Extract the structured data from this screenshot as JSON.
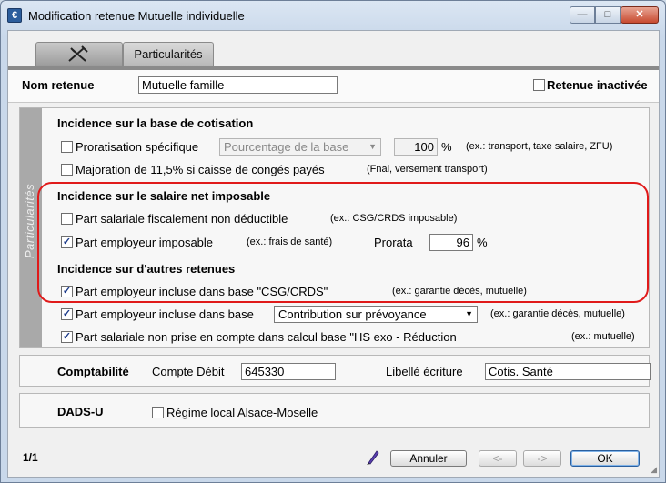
{
  "window": {
    "title": "Modification retenue Mutuelle individuelle",
    "app_icon": "€",
    "min_glyph": "—",
    "max_glyph": "□",
    "close_glyph": "✕"
  },
  "tabs": [
    {
      "label": "",
      "icon": "tools-icon"
    },
    {
      "label": "Particularités"
    }
  ],
  "name_row": {
    "label": "Nom retenue",
    "value": "Mutuelle famille",
    "inactive_label": "Retenue inactivée",
    "inactive_checked": false
  },
  "sidebar_label": "Particularités",
  "section_base": {
    "title": "Incidence sur la base de cotisation",
    "proratisation_label": "Proratisation spécifique",
    "proratisation_checked": false,
    "proratisation_select": "Pourcentage de la base",
    "proratisation_value": "100",
    "proratisation_unit": "%",
    "proratisation_hint": "(ex.: transport, taxe salaire, ZFU)",
    "majoration_label": "Majoration de 11,5% si caisse de congés payés",
    "majoration_checked": false,
    "majoration_hint": "(Fnal, versement transport)"
  },
  "section_salaire": {
    "title": "Incidence sur le salaire net imposable",
    "part_salariale_label": "Part salariale fiscalement non déductible",
    "part_salariale_checked": false,
    "part_salariale_hint": "(ex.: CSG/CRDS imposable)",
    "part_employeur_label": "Part employeur imposable",
    "part_employeur_checked": true,
    "part_employeur_hint": "(ex.: frais de santé)",
    "prorata_label": "Prorata",
    "prorata_value": "96",
    "prorata_unit": "%"
  },
  "section_autres": {
    "title": "Incidence sur d'autres retenues",
    "csg_label": "Part employeur incluse dans base \"CSG/CRDS\"",
    "csg_checked": true,
    "csg_hint": "(ex.: garantie décès, mutuelle)",
    "base_label": "Part employeur incluse dans base",
    "base_checked": true,
    "base_select": "Contribution sur prévoyance",
    "base_hint": "(ex.: garantie décès, mutuelle)",
    "hs_label": "Part salariale non prise en compte dans calcul base \"HS exo - Réduction",
    "hs_checked": true,
    "hs_hint": "(ex.: mutuelle)"
  },
  "comptabilite": {
    "title": "Comptabilité",
    "compte_label": "Compte Débit",
    "compte_value": "645330",
    "libelle_label": "Libellé écriture",
    "libelle_value": "Cotis. Santé"
  },
  "dadsu": {
    "title": "DADS-U",
    "regime_label": "Régime local Alsace-Moselle",
    "regime_checked": false
  },
  "footer": {
    "page": "1/1",
    "annuler": "Annuler",
    "prev": "<-",
    "next": "->",
    "ok": "OK"
  },
  "colors": {
    "highlight_border": "#e01a1a",
    "sidebar": "#a9a9a9"
  }
}
